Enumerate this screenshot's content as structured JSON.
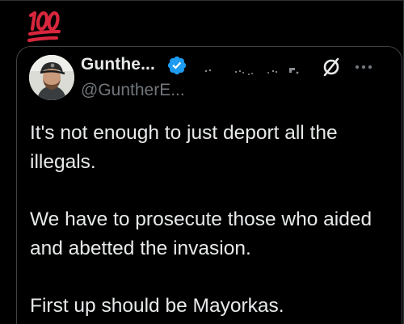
{
  "reaction_emoji": {
    "icon": "hundred-points-emoji-icon",
    "color": "#e0245e"
  },
  "quoted_post": {
    "display_name": "Gunthe...",
    "handle": "@GuntherE...",
    "verified_icon": "verified-badge-icon",
    "verified_color": "#1d9bf0",
    "more_icon": "more-options-icon",
    "null_icon": "empty-set-icon",
    "paragraphs": [
      "It's not enough to just deport all the illegals.",
      "We have to prosecute those who aided and abetted the invasion.",
      "First up should be Mayorkas."
    ]
  }
}
